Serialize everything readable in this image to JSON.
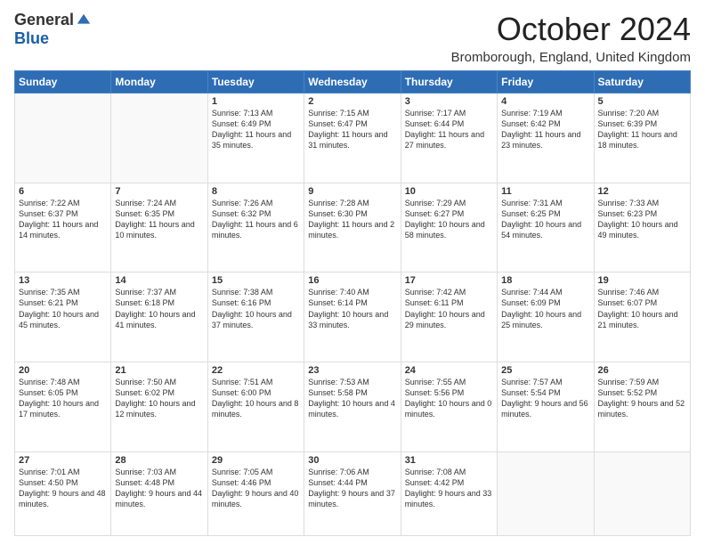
{
  "header": {
    "logo_general": "General",
    "logo_blue": "Blue",
    "month_title": "October 2024",
    "location": "Bromborough, England, United Kingdom"
  },
  "days_of_week": [
    "Sunday",
    "Monday",
    "Tuesday",
    "Wednesday",
    "Thursday",
    "Friday",
    "Saturday"
  ],
  "weeks": [
    [
      {
        "day": "",
        "info": ""
      },
      {
        "day": "",
        "info": ""
      },
      {
        "day": "1",
        "info": "Sunrise: 7:13 AM\nSunset: 6:49 PM\nDaylight: 11 hours and 35 minutes."
      },
      {
        "day": "2",
        "info": "Sunrise: 7:15 AM\nSunset: 6:47 PM\nDaylight: 11 hours and 31 minutes."
      },
      {
        "day": "3",
        "info": "Sunrise: 7:17 AM\nSunset: 6:44 PM\nDaylight: 11 hours and 27 minutes."
      },
      {
        "day": "4",
        "info": "Sunrise: 7:19 AM\nSunset: 6:42 PM\nDaylight: 11 hours and 23 minutes."
      },
      {
        "day": "5",
        "info": "Sunrise: 7:20 AM\nSunset: 6:39 PM\nDaylight: 11 hours and 18 minutes."
      }
    ],
    [
      {
        "day": "6",
        "info": "Sunrise: 7:22 AM\nSunset: 6:37 PM\nDaylight: 11 hours and 14 minutes."
      },
      {
        "day": "7",
        "info": "Sunrise: 7:24 AM\nSunset: 6:35 PM\nDaylight: 11 hours and 10 minutes."
      },
      {
        "day": "8",
        "info": "Sunrise: 7:26 AM\nSunset: 6:32 PM\nDaylight: 11 hours and 6 minutes."
      },
      {
        "day": "9",
        "info": "Sunrise: 7:28 AM\nSunset: 6:30 PM\nDaylight: 11 hours and 2 minutes."
      },
      {
        "day": "10",
        "info": "Sunrise: 7:29 AM\nSunset: 6:27 PM\nDaylight: 10 hours and 58 minutes."
      },
      {
        "day": "11",
        "info": "Sunrise: 7:31 AM\nSunset: 6:25 PM\nDaylight: 10 hours and 54 minutes."
      },
      {
        "day": "12",
        "info": "Sunrise: 7:33 AM\nSunset: 6:23 PM\nDaylight: 10 hours and 49 minutes."
      }
    ],
    [
      {
        "day": "13",
        "info": "Sunrise: 7:35 AM\nSunset: 6:21 PM\nDaylight: 10 hours and 45 minutes."
      },
      {
        "day": "14",
        "info": "Sunrise: 7:37 AM\nSunset: 6:18 PM\nDaylight: 10 hours and 41 minutes."
      },
      {
        "day": "15",
        "info": "Sunrise: 7:38 AM\nSunset: 6:16 PM\nDaylight: 10 hours and 37 minutes."
      },
      {
        "day": "16",
        "info": "Sunrise: 7:40 AM\nSunset: 6:14 PM\nDaylight: 10 hours and 33 minutes."
      },
      {
        "day": "17",
        "info": "Sunrise: 7:42 AM\nSunset: 6:11 PM\nDaylight: 10 hours and 29 minutes."
      },
      {
        "day": "18",
        "info": "Sunrise: 7:44 AM\nSunset: 6:09 PM\nDaylight: 10 hours and 25 minutes."
      },
      {
        "day": "19",
        "info": "Sunrise: 7:46 AM\nSunset: 6:07 PM\nDaylight: 10 hours and 21 minutes."
      }
    ],
    [
      {
        "day": "20",
        "info": "Sunrise: 7:48 AM\nSunset: 6:05 PM\nDaylight: 10 hours and 17 minutes."
      },
      {
        "day": "21",
        "info": "Sunrise: 7:50 AM\nSunset: 6:02 PM\nDaylight: 10 hours and 12 minutes."
      },
      {
        "day": "22",
        "info": "Sunrise: 7:51 AM\nSunset: 6:00 PM\nDaylight: 10 hours and 8 minutes."
      },
      {
        "day": "23",
        "info": "Sunrise: 7:53 AM\nSunset: 5:58 PM\nDaylight: 10 hours and 4 minutes."
      },
      {
        "day": "24",
        "info": "Sunrise: 7:55 AM\nSunset: 5:56 PM\nDaylight: 10 hours and 0 minutes."
      },
      {
        "day": "25",
        "info": "Sunrise: 7:57 AM\nSunset: 5:54 PM\nDaylight: 9 hours and 56 minutes."
      },
      {
        "day": "26",
        "info": "Sunrise: 7:59 AM\nSunset: 5:52 PM\nDaylight: 9 hours and 52 minutes."
      }
    ],
    [
      {
        "day": "27",
        "info": "Sunrise: 7:01 AM\nSunset: 4:50 PM\nDaylight: 9 hours and 48 minutes."
      },
      {
        "day": "28",
        "info": "Sunrise: 7:03 AM\nSunset: 4:48 PM\nDaylight: 9 hours and 44 minutes."
      },
      {
        "day": "29",
        "info": "Sunrise: 7:05 AM\nSunset: 4:46 PM\nDaylight: 9 hours and 40 minutes."
      },
      {
        "day": "30",
        "info": "Sunrise: 7:06 AM\nSunset: 4:44 PM\nDaylight: 9 hours and 37 minutes."
      },
      {
        "day": "31",
        "info": "Sunrise: 7:08 AM\nSunset: 4:42 PM\nDaylight: 9 hours and 33 minutes."
      },
      {
        "day": "",
        "info": ""
      },
      {
        "day": "",
        "info": ""
      }
    ]
  ]
}
